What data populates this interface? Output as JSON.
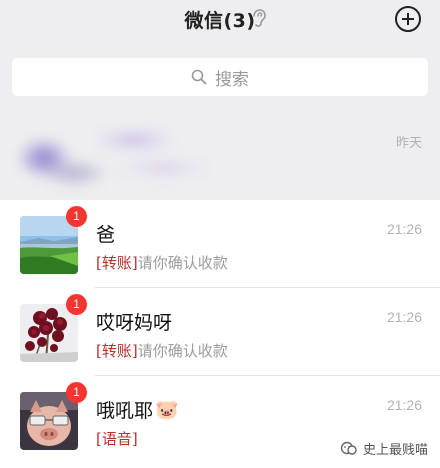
{
  "header": {
    "title": "微信",
    "count": "(3)",
    "mute_icon": "ear-icon",
    "add_icon": "plus-circle-icon"
  },
  "search": {
    "icon": "search-icon",
    "placeholder": "搜索"
  },
  "blurred_chat": {
    "time": "昨天"
  },
  "chats": [
    {
      "name": "爸",
      "emoji": "",
      "badge": "1",
      "tag": "[转账]",
      "preview": "请你确认收款",
      "time": "21:26",
      "avatar": "landscape-avatar"
    },
    {
      "name": "哎呀妈呀",
      "emoji": "",
      "badge": "1",
      "tag": "[转账]",
      "preview": "请你确认收款",
      "time": "21:26",
      "avatar": "flowers-avatar"
    },
    {
      "name": "哦吼耶",
      "emoji": "🐷",
      "badge": "1",
      "tag": "[语音]",
      "preview": "",
      "time": "21:26",
      "avatar": "pig-avatar"
    }
  ],
  "watermark": {
    "icon": "wechat-channel-icon",
    "text": "史上最贱喵"
  },
  "colors": {
    "badge": "#f43530",
    "tag": "#b8302e",
    "header_bg": "#eeeef0"
  }
}
